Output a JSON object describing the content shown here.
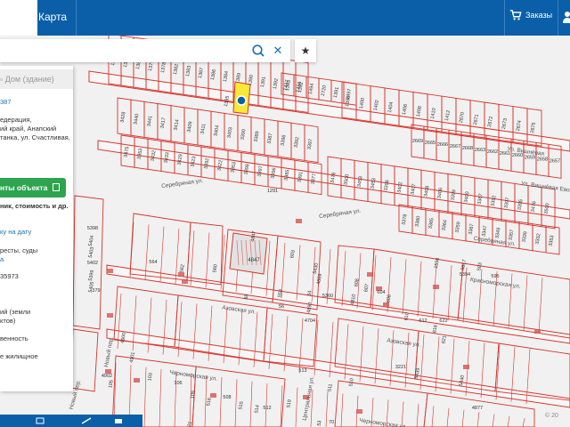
{
  "topbar": {
    "tab_map_label": "Карта",
    "orders_label": "Заказы"
  },
  "panel": {
    "header": "Дом (здание)",
    "number": "387",
    "address_lines": [
      "едерация,",
      "ий край, Анапский",
      "танка, ул. Счастливая,"
    ],
    "documents_button": "нты объекта",
    "documents_sub": "ник, стоимость и др.",
    "date_link": "ку на дату",
    "lines_a": [
      "ресты, суды",
      "а"
    ],
    "number_b": "35973",
    "lines_c": [
      "ий (земли",
      "ктов)"
    ],
    "line_d": "венность",
    "line_e": "е жилищное"
  },
  "map": {
    "streets": [
      {
        "label": "Серебряная ул."
      },
      {
        "label": "Серебряная ул."
      },
      {
        "label": "Серебряная ул."
      },
      {
        "label": "Азовская ул."
      },
      {
        "label": "Азовская ул."
      },
      {
        "label": "Черноморская ул."
      },
      {
        "label": "Черноморская ул."
      },
      {
        "label": "Красноморская ул."
      },
      {
        "label": "Ул. Вишнёвая"
      },
      {
        "label": "Ул. Вишнёвая Евой"
      },
      {
        "label": "Новый пер."
      },
      {
        "label": "Новый пер."
      },
      {
        "label": "Центральная ул."
      }
    ],
    "row1_labels": [
      "1384",
      "1385",
      "1380",
      "1379",
      "1378",
      "1382",
      "1383",
      "1387",
      "1386",
      "1384",
      "1389",
      "1390",
      "1391",
      "1392",
      "1393",
      "1392"
    ],
    "row1b_labels": [
      "1497",
      "1496",
      "1494",
      "2720",
      "1391"
    ],
    "row2_labels": [
      "1398",
      "1400",
      "1402",
      "1404",
      "1406",
      "1408",
      "1410",
      "1412",
      "2670",
      "2671",
      "2672",
      "2673",
      "2674",
      "2675"
    ],
    "row3_labels": [
      "3428",
      "3440",
      "3441",
      "3417",
      "3414",
      "3409",
      "3411",
      "3404",
      "3403",
      "3390",
      "3389",
      "3387",
      "3396",
      "3392",
      "3397"
    ],
    "row4_labels": [
      "3475",
      "3353",
      "3432",
      "3433",
      "3429",
      "3423",
      "3392",
      "3422",
      "3353",
      "3398",
      "3397",
      "3396",
      "3385",
      "3391",
      "3377"
    ],
    "row5_labels": [
      "3378",
      "3380",
      "3365",
      "3364",
      "3359",
      "3367",
      "3347",
      "3349",
      "3357",
      "3339",
      "3332",
      "3353",
      "3383",
      "3419",
      "3429"
    ],
    "row6_labels": [
      "2669",
      "2665",
      "2666",
      "2667",
      "2668",
      "2663",
      "2662",
      "2661",
      "2660",
      "2659",
      "2658",
      "2657",
      "2656",
      "2654",
      "2653"
    ],
    "row7_labels": [
      "3476",
      "3500",
      "3453",
      "3453",
      "3396",
      "3402",
      "3407",
      "3408",
      "3406",
      "3399",
      "3400",
      "3387",
      "3392",
      "3397",
      "3395"
    ],
    "misc_labels": [
      "1291",
      "4847",
      "603",
      "5398",
      "5404",
      "5403",
      "5402",
      "5399",
      "5405",
      "564",
      "562",
      "560",
      "379",
      "58",
      "559",
      "56",
      "54",
      "4890",
      "4704",
      "5430",
      "4869",
      "5360",
      "4810",
      "1596",
      "5394",
      "8817",
      "593",
      "595",
      "608",
      "607",
      "604",
      "606",
      "610",
      "612",
      "616",
      "621",
      "622",
      "4900",
      "4901",
      "4902",
      "105",
      "103",
      "106",
      "109",
      "516",
      "508",
      "515",
      "514",
      "513",
      "511",
      "510",
      "512",
      "519",
      "53",
      "70",
      "537",
      "3321",
      "3221",
      "5439",
      "5440",
      "4877",
      "5334",
      "5334",
      "3338",
      "3391"
    ],
    "special_lot": "1385"
  },
  "colors": {
    "brand": "#0a5fa8",
    "parcel_line": "#d9342b",
    "selected_lot": "#f6ea36",
    "marker": "#0a5fa8",
    "button_green": "#2ea44f"
  },
  "icons": {
    "search": "search-icon",
    "close": "close-icon",
    "star": "star-icon",
    "cart": "cart-icon",
    "user": "user-icon",
    "doc": "document-icon"
  }
}
